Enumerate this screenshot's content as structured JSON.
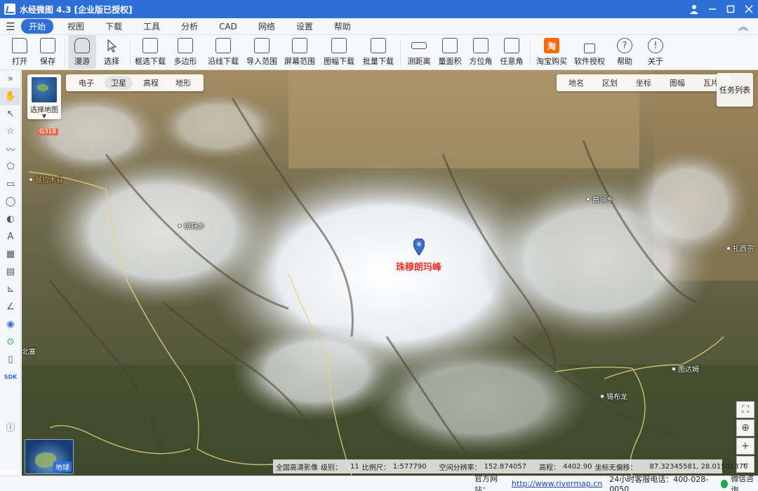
{
  "window": {
    "title": "水经微图 4.3 [企业版已授权]"
  },
  "menu": {
    "items": [
      "开始",
      "视图",
      "下载",
      "工具",
      "分析",
      "CAD",
      "网络",
      "设置",
      "帮助"
    ],
    "active": "开始"
  },
  "toolbar": {
    "items": [
      {
        "label": "打开",
        "icon": "folder-icon"
      },
      {
        "label": "保存",
        "icon": "save-icon"
      },
      {
        "label": "漫游",
        "icon": "hand-icon"
      },
      {
        "label": "选择",
        "icon": "pointer-icon"
      },
      {
        "label": "框选下载",
        "icon": "box-download-icon"
      },
      {
        "label": "多边形",
        "icon": "polygon-icon"
      },
      {
        "label": "沿线下载",
        "icon": "line-download-icon"
      },
      {
        "label": "导入范围",
        "icon": "import-icon"
      },
      {
        "label": "屏幕范围",
        "icon": "screen-icon"
      },
      {
        "label": "图幅下载",
        "icon": "sheet-download-icon"
      },
      {
        "label": "批量下载",
        "icon": "batch-download-icon"
      },
      {
        "label": "测距离",
        "icon": "ruler-icon"
      },
      {
        "label": "量面积",
        "icon": "area-icon"
      },
      {
        "label": "方位角",
        "icon": "azimuth-icon"
      },
      {
        "label": "任意角",
        "icon": "angle-icon"
      },
      {
        "label": "淘宝购买",
        "icon": "taobao-icon"
      },
      {
        "label": "软件授权",
        "icon": "lock-icon"
      },
      {
        "label": "帮助",
        "icon": "help-icon"
      },
      {
        "label": "关于",
        "icon": "info-icon"
      }
    ],
    "active": "漫游"
  },
  "map": {
    "selector_label": "选择地图",
    "layer_tabs": [
      "电子",
      "卫星",
      "高程",
      "地形"
    ],
    "active_layer": "卫星",
    "overlay_tabs": [
      "地名",
      "区划",
      "坐标",
      "图幅",
      "瓦片"
    ],
    "task_list": "任务列表",
    "road_badge": "G318",
    "places": {
      "p1": "聂拉木县",
      "p2": "绒辖乡",
      "p3": "曲当乡",
      "p4": "扎西宗",
      "p5": "锡布龙",
      "p6": "图达姆",
      "p7": "北塞"
    },
    "peak_label": "珠穆朗玛峰",
    "globe_label": "地球"
  },
  "map_status": {
    "source": "全国高清影像",
    "level_label": "级别：",
    "level": "11",
    "scale_label": "比例尺：",
    "scale": "1:577790",
    "resolution_label": "空间分辨率：",
    "resolution": "152.874057",
    "elevation_label": "高程：",
    "elevation": "4402.90",
    "offset_label": "坐标无偏移：",
    "coordinates": "87.32345581, 28.01501376"
  },
  "statusbar": {
    "site_label": "官方网站：",
    "site_url": "http://www.rivermap.cn",
    "phone": "24小时客服电话：400-028-0050",
    "wechat": "微信咨询"
  },
  "colors": {
    "accent": "#2d6fd6",
    "peak_label": "#e8322c"
  }
}
